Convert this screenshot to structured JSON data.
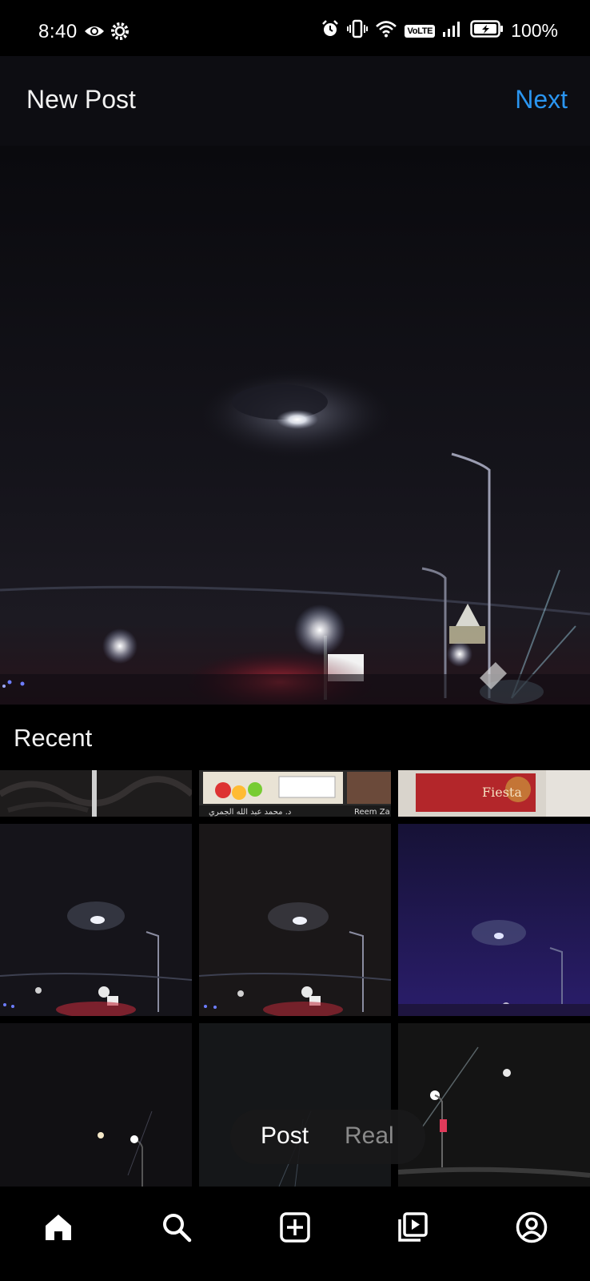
{
  "status_bar": {
    "time": "8:40",
    "battery_percent": "100%",
    "network_badge": "VoLTE",
    "icons": [
      "eye-icon",
      "settings-gear-icon",
      "alarm-icon",
      "vibrate-icon",
      "wifi-icon",
      "signal-icon",
      "battery-charging-icon"
    ]
  },
  "header": {
    "title": "New Post",
    "next_label": "Next"
  },
  "recent": {
    "label": "Recent",
    "thumbnail_captions": {
      "thumb2_left": "د. محمد عبد الله الجمري",
      "thumb2_right": "Reem Za",
      "thumb3_brand": "Fiesta"
    }
  },
  "mode_toggle": {
    "post_label": "Post",
    "reel_label": "Real"
  },
  "bottom_nav": {
    "items": [
      "home-icon",
      "search-icon",
      "add-post-icon",
      "reels-icon",
      "profile-icon"
    ]
  },
  "colors": {
    "accent": "#2a95f0",
    "header_bg": "#0d0d12",
    "background": "#000000"
  }
}
